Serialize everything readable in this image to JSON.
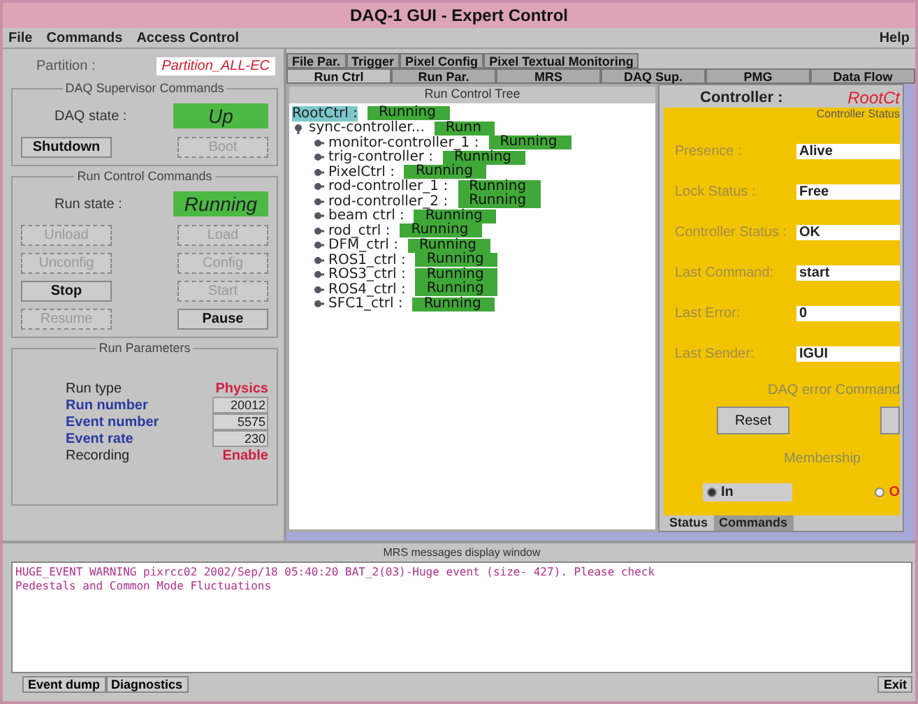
{
  "window": {
    "title": "DAQ-1 GUI - Expert Control"
  },
  "menu": [
    "File",
    "Commands",
    "Access Control"
  ],
  "help_menu": "Help",
  "partition": {
    "label": "Partition :",
    "value": "Partition_ALL-EC"
  },
  "daq_supervisor": {
    "title": "DAQ Supervisor Commands",
    "state_label": "DAQ state :",
    "state": "Up",
    "buttons": [
      {
        "label": "Shutdown",
        "disabled": false
      },
      {
        "label": "Boot",
        "disabled": true
      }
    ]
  },
  "run_control": {
    "title": "Run Control Commands",
    "state_label": "Run state :",
    "state": "Running",
    "buttons": [
      {
        "label": "Unload",
        "disabled": true
      },
      {
        "label": "Load",
        "disabled": true
      },
      {
        "label": "Unconfig",
        "disabled": true
      },
      {
        "label": "Config",
        "disabled": true
      },
      {
        "label": "Stop",
        "disabled": false
      },
      {
        "label": "Start",
        "disabled": true
      },
      {
        "label": "Resume",
        "disabled": true
      },
      {
        "label": "Pause",
        "disabled": false
      }
    ]
  },
  "run_parameters": {
    "title": "Run Parameters",
    "rows": [
      {
        "kind": "text",
        "label": "Run type",
        "value": "Physics"
      },
      {
        "kind": "field",
        "label": "Run number",
        "value": "20012"
      },
      {
        "kind": "field",
        "label": "Event number",
        "value": "5575"
      },
      {
        "kind": "field",
        "label": "Event rate",
        "value": "230"
      },
      {
        "kind": "text",
        "label": "Recording",
        "value": "Enable"
      }
    ]
  },
  "tabs_row_1": [
    {
      "label": "File Par.",
      "selected": false
    },
    {
      "label": "Trigger",
      "selected": false
    },
    {
      "label": "Pixel Config",
      "selected": false
    },
    {
      "label": "Pixel Textual Monitoring",
      "selected": false
    }
  ],
  "tabs_row_2": [
    {
      "label": "Run Ctrl",
      "selected": true
    },
    {
      "label": "Run Par.",
      "selected": false
    },
    {
      "label": "MRS",
      "selected": false
    },
    {
      "label": "DAQ Sup.",
      "selected": false
    },
    {
      "label": "PMG",
      "selected": false
    },
    {
      "label": "Data Flow",
      "selected": false
    }
  ],
  "tree": {
    "title": "Run Control Tree",
    "nodes": [
      {
        "label": "RootCtrl :",
        "status": "Running",
        "selected": true,
        "children": [
          {
            "label": "sync-controller...",
            "status": "Runn",
            "selected": false,
            "expanded": true,
            "children": [
              {
                "label": "monitor-controller_1 :",
                "status": "Running",
                "selected": false,
                "expanded": false
              },
              {
                "label": "trig-controller :",
                "status": "Running",
                "selected": false,
                "expanded": false
              },
              {
                "label": "PixelCtrl :",
                "status": "Running",
                "selected": false,
                "expanded": false
              },
              {
                "label": "rod-controller_1 :",
                "status": "Running",
                "selected": false,
                "expanded": false
              },
              {
                "label": "rod-controller_2 :",
                "status": "Running",
                "selected": false,
                "expanded": false
              },
              {
                "label": "beam ctrl :",
                "status": "Running",
                "selected": false,
                "expanded": false
              },
              {
                "label": "rod_ctrl :",
                "status": "Running",
                "selected": false,
                "expanded": false
              },
              {
                "label": "DFM_ctrl :",
                "status": "Running",
                "selected": false,
                "expanded": false
              },
              {
                "label": "ROS1_ctrl :",
                "status": "Running",
                "selected": false,
                "expanded": false
              },
              {
                "label": "ROS3_ctrl :",
                "status": "Running",
                "selected": false,
                "expanded": false
              },
              {
                "label": "ROS4_ctrl :",
                "status": "Running",
                "selected": false,
                "expanded": false
              },
              {
                "label": "SFC1_ctrl :",
                "status": "Running",
                "selected": false,
                "expanded": false
              }
            ]
          }
        ]
      }
    ]
  },
  "controller": {
    "label": "Controller :",
    "name": "RootCt",
    "status_title": "Controller Status",
    "fields": [
      {
        "label": "Presence :",
        "value": "Alive"
      },
      {
        "label": "Lock Status :",
        "value": "Free"
      },
      {
        "label": "Controller Status :",
        "value": "OK"
      },
      {
        "label": "Last Command:",
        "value": "start"
      },
      {
        "label": "Last Error:",
        "value": "0"
      },
      {
        "label": "Last Sender:",
        "value": "IGUI"
      }
    ],
    "error_title": "DAQ error Command",
    "reset_button": "Reset",
    "membership_title": "Membership",
    "radios": [
      {
        "label": "In",
        "selected": true
      },
      {
        "label": "O",
        "selected": false
      }
    ],
    "tabs": [
      {
        "label": "Status",
        "selected": false
      },
      {
        "label": "Commands",
        "selected": true
      }
    ]
  },
  "mrs": {
    "title": "MRS messages display window",
    "lines": [
      "HUGE_EVENT WARNING pixrcc02 2002/Sep/18 05:40:20  BAT_2(03)-Huge event (size- 427). Please check",
      "Pedestals and Common Mode Fluctuations"
    ]
  },
  "bottom_buttons": [
    "Event dump",
    "Diagnostics"
  ],
  "exit_button": "Exit"
}
